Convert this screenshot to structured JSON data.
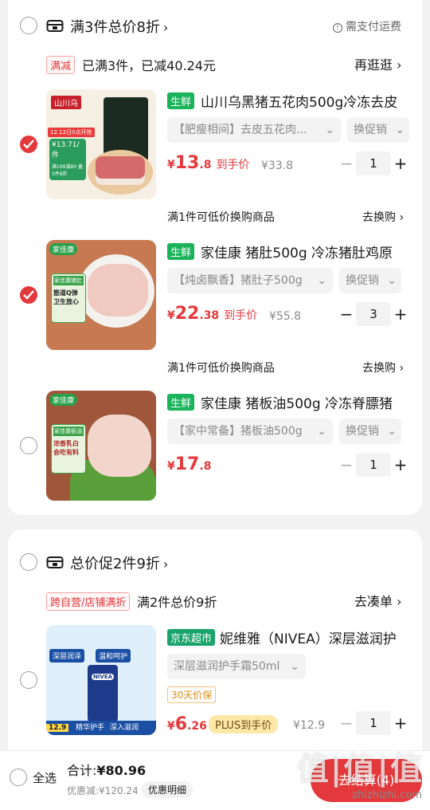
{
  "colors": {
    "accent": "#e4393c",
    "fresh": "#19b35a",
    "jd": "#1aa36b"
  },
  "group1": {
    "title": "满3件总价8折",
    "shipping_note": "需支付运费",
    "promo_tag": "满减",
    "promo_text": "已满3件，已减40.24元",
    "promo_link": "再逛逛",
    "items": [
      {
        "checked": true,
        "tag": "生鲜",
        "title": "山川乌黑猪五花肉500g冷冻去皮",
        "spec": "【肥瘦相间】去皮五花肉...",
        "swap": "换促销",
        "price_symbol": "¥",
        "price_int": "13",
        "price_dec": ".8",
        "price_suffix": "到手价",
        "orig": "¥33.8",
        "qty": "1",
        "thumb_text_1": "山川乌",
        "thumb_text_2": "12.12日0点开抢",
        "thumb_text_3": "¥13.71/件",
        "thumb_text_4": "满199减80 叠3件8折"
      },
      {
        "checked": true,
        "tag": "生鲜",
        "title": "家佳康 猪肚500g 冷冻猪肚鸡原",
        "spec": "【炖卤飘香】猪肚子500g",
        "swap": "换促销",
        "price_symbol": "¥",
        "price_int": "22",
        "price_dec": ".38",
        "price_suffix": "到手价",
        "orig": "¥55.8",
        "qty": "3",
        "thumb_text_1": "家佳康",
        "thumb_text_2": "家佳康猪肚",
        "thumb_text_3": "筋道Q弹 卫生放心"
      },
      {
        "checked": false,
        "tag": "生鲜",
        "title": "家佳康 猪板油500g 冷冻脊膘猪",
        "spec": "【家中常备】猪板油500g",
        "swap": "换促销",
        "price_symbol": "¥",
        "price_int": "17",
        "price_dec": ".8",
        "price_suffix": "",
        "orig": "",
        "qty": "1",
        "thumb_text_1": "家佳康",
        "thumb_text_2": "家佳康板油",
        "thumb_text_3": "浓香乳白 会吃有料"
      }
    ],
    "exchange_rows": [
      {
        "text": "满1件可低价换购商品",
        "link": "去换购"
      },
      {
        "text": "满1件可低价换购商品",
        "link": "去换购"
      }
    ]
  },
  "group2": {
    "title": "总价促2件9折",
    "promo_tag": "跨自营/店铺满折",
    "promo_text": "满2件总价9折",
    "promo_link": "去凑单",
    "item": {
      "checked": false,
      "tag": "京东超市",
      "title": "妮维雅（NIVEA）深层滋润护",
      "spec": "深层滋润护手霜50ml",
      "days_tag": "30天价保",
      "price_symbol": "¥",
      "price_int": "6",
      "price_dec": ".26",
      "plus_tag": "PLUS到手价",
      "orig": "¥12.9",
      "qty": "1",
      "thumb_text_1": "深层润泽",
      "thumb_text_2": "温和呵护",
      "thumb_text_3": "NIVEA",
      "thumb_text_4": "精华护手",
      "thumb_text_5": "深入滋润",
      "thumb_text_6": "12.9"
    }
  },
  "bottom": {
    "select_all": "全选",
    "total_label": "合计:",
    "total_value": "¥80.96",
    "discount_label": "优惠减:",
    "discount_value": "¥120.24",
    "detail_button": "优惠明细",
    "checkout_label": "去结算(4)",
    "watermark": "值|值|值",
    "watermark_url": "zhizhizhi.com"
  }
}
